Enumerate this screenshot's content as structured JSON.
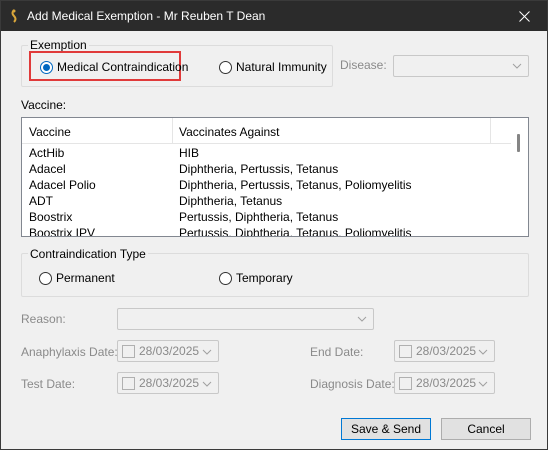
{
  "window": {
    "title": "Add Medical Exemption - Mr Reuben T Dean",
    "close_icon": "close-icon",
    "app_icon": "app-icon"
  },
  "exemption": {
    "group_label": "Exemption",
    "options": [
      {
        "label": "Medical Contraindication",
        "selected": true
      },
      {
        "label": "Natural Immunity",
        "selected": false
      }
    ],
    "highlight_color": "#e03a3a"
  },
  "disease": {
    "label": "Disease:",
    "value": ""
  },
  "vaccine": {
    "label": "Vaccine:",
    "columns": [
      "Vaccine",
      "Vaccinates Against"
    ],
    "rows": [
      [
        "ActHib",
        "HIB"
      ],
      [
        "Adacel",
        "Diphtheria, Pertussis, Tetanus"
      ],
      [
        "Adacel Polio",
        "Diphtheria, Pertussis, Tetanus, Poliomyelitis"
      ],
      [
        "ADT",
        "Diphtheria, Tetanus"
      ],
      [
        "Boostrix",
        "Pertussis, Diphtheria, Tetanus"
      ],
      [
        "Boostrix IPV",
        "Pertussis, Diphtheria, Tetanus, Poliomyelitis"
      ]
    ]
  },
  "contraindication": {
    "group_label": "Contraindication Type",
    "options": [
      {
        "label": "Permanent",
        "selected": false
      },
      {
        "label": "Temporary",
        "selected": false
      }
    ]
  },
  "reason": {
    "label": "Reason:",
    "value": ""
  },
  "dates": {
    "anaphylaxis": {
      "label": "Anaphylaxis Date:",
      "value": "28/03/2025"
    },
    "end": {
      "label": "End Date:",
      "value": "28/03/2025"
    },
    "test": {
      "label": "Test Date:",
      "value": "28/03/2025"
    },
    "diagnosis": {
      "label": "Diagnosis Date:",
      "value": "28/03/2025"
    }
  },
  "buttons": {
    "save_send": "Save & Send",
    "cancel": "Cancel"
  },
  "colors": {
    "accent": "#0067c0",
    "titlebar": "#2b2b2b",
    "disabled_text": "#8a8a8a"
  }
}
